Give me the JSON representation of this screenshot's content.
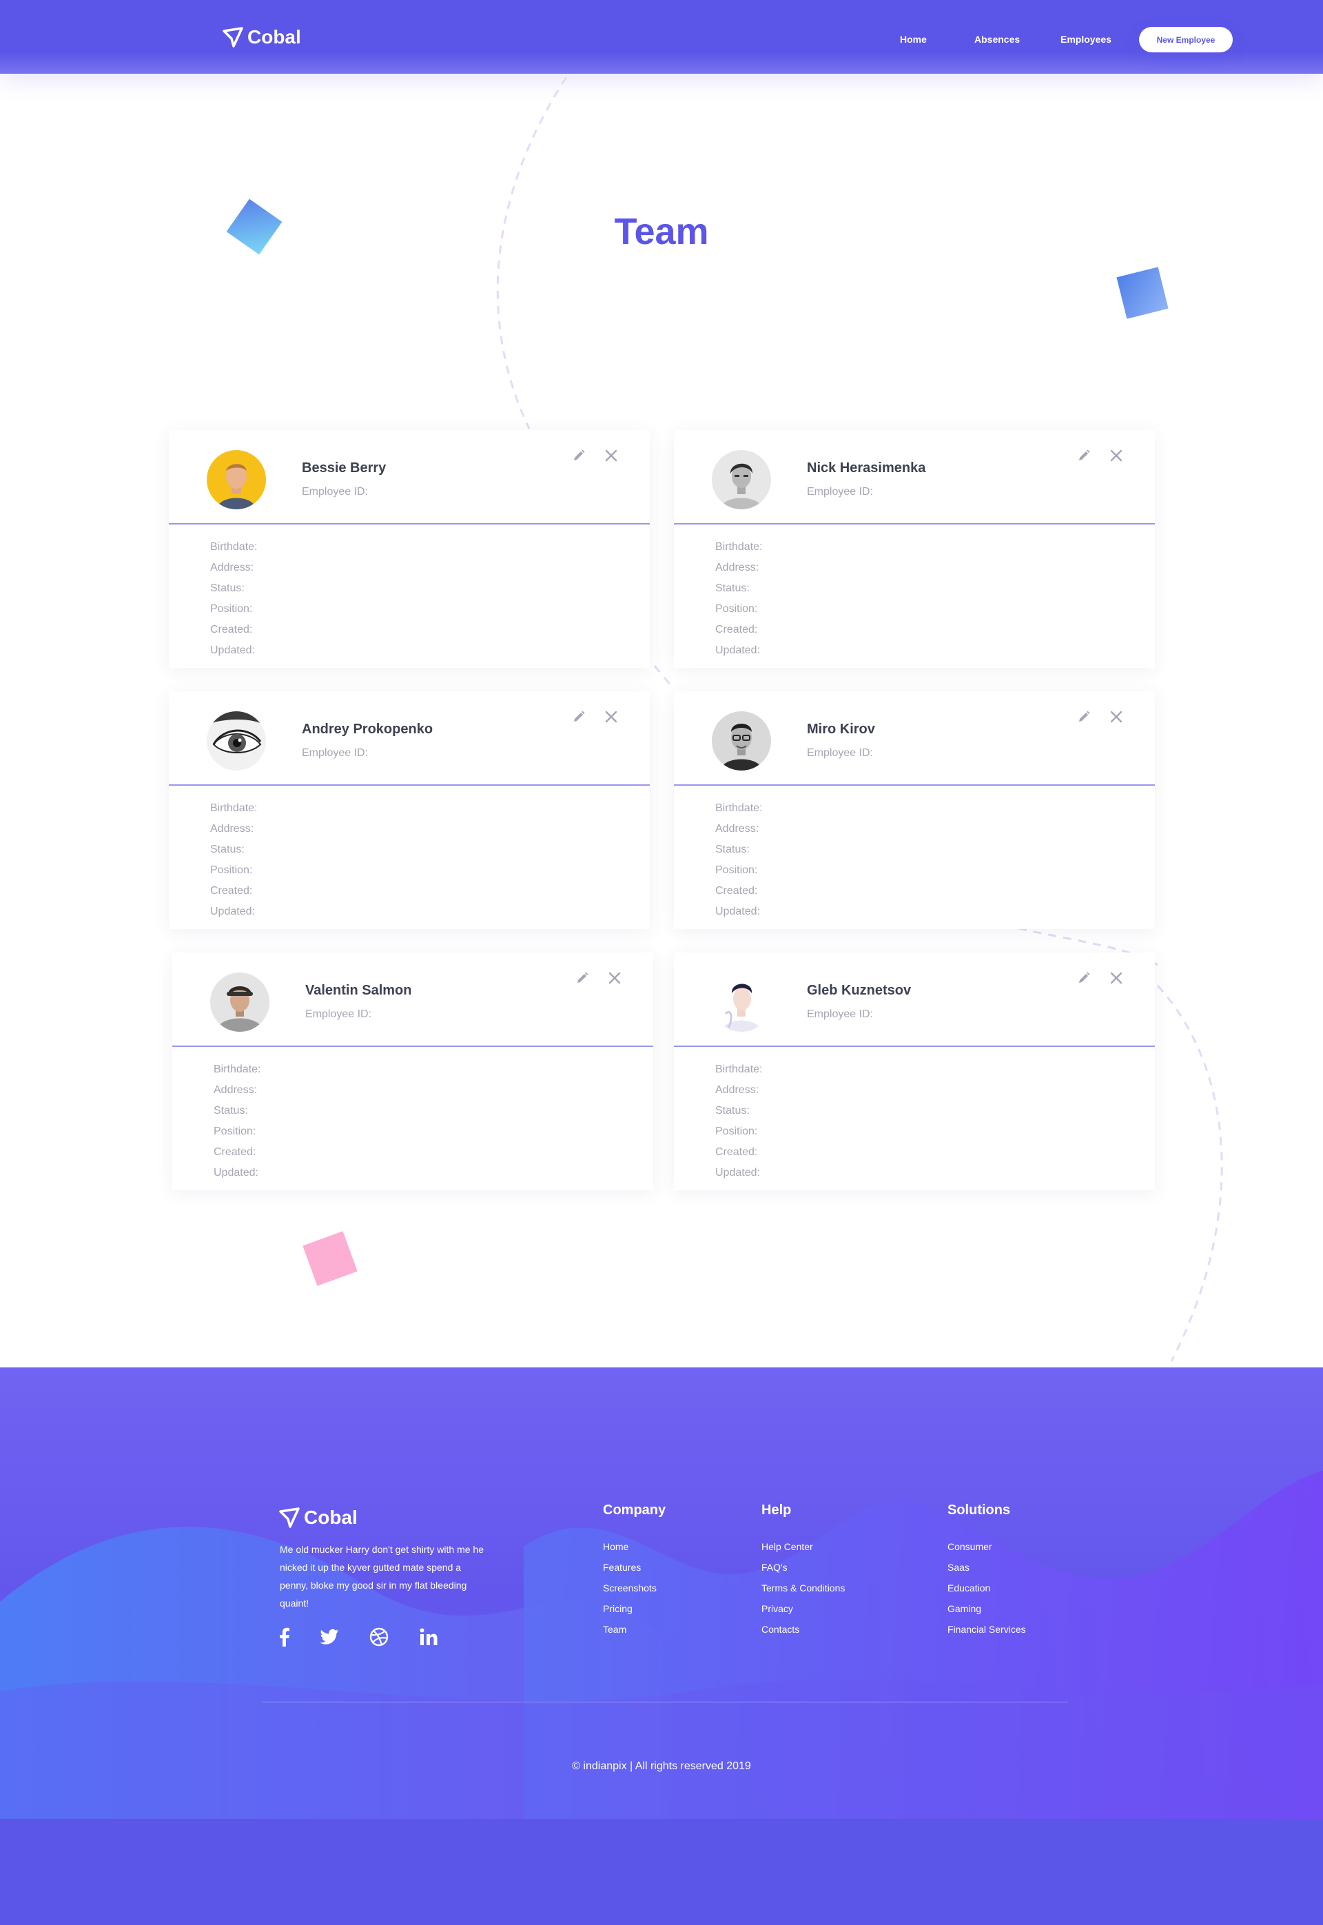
{
  "brand": {
    "name": "Cobal",
    "accent_color": "#5b55e8"
  },
  "nav": {
    "items": [
      {
        "label": "Home"
      },
      {
        "label": "Absences"
      },
      {
        "label": "Employees"
      }
    ],
    "cta_label": "New Employee"
  },
  "page": {
    "title": "Team"
  },
  "employee_fields": {
    "birthdate": "Birthdate:",
    "address": "Address:",
    "status": "Status:",
    "position": "Position:",
    "created": "Created:",
    "updated": "Updated:",
    "id_label": "Employee ID:"
  },
  "employees": [
    {
      "name": "Bessie Berry"
    },
    {
      "name": "Nick Herasimenka"
    },
    {
      "name": "Andrey Prokopenko"
    },
    {
      "name": "Miro Kirov"
    },
    {
      "name": "Valentin Salmon"
    },
    {
      "name": "Gleb Kuznetsov"
    }
  ],
  "card_icons": {
    "edit": "pencil-icon",
    "delete": "close-icon"
  },
  "footer": {
    "brand": "Cobal",
    "description": "Me old mucker Harry don't get shirty with me he nicked it up the kyver gutted mate spend a penny, bloke my good sir in my flat bleeding quaint!",
    "social": [
      "facebook-icon",
      "twitter-icon",
      "dribbble-icon",
      "linkedin-icon"
    ],
    "columns": [
      {
        "title": "Company",
        "links": [
          "Home",
          "Features",
          "Screenshots",
          "Pricing",
          "Team"
        ]
      },
      {
        "title": "Help",
        "links": [
          "Help Center",
          "FAQ's",
          "Terms & Conditions",
          "Privacy",
          "Contacts"
        ]
      },
      {
        "title": "Solutions",
        "links": [
          "Consumer",
          "Saas",
          "Education",
          "Gaming",
          "Financial Services"
        ]
      }
    ],
    "copyright": "© indianpix | All rights reserved 2019"
  }
}
